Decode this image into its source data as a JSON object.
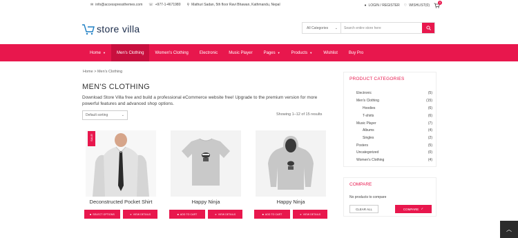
{
  "topbar": {
    "email": "info@accesspressthemes.com",
    "phone": "+977-1-4671980",
    "address": "Mathuri Sadan, 5th floor Ravi Bhawan, Kathmandu, Nepal",
    "login": "LOGIN / REGISTER",
    "wishlist": "WISHLIST(0)",
    "cart_count": "0"
  },
  "header": {
    "logo_store": "store",
    "logo_villa": "villa",
    "search": {
      "category": "All Categories",
      "placeholder": "Search entire store here"
    }
  },
  "nav": {
    "items": [
      {
        "label": "Home",
        "dropdown": true
      },
      {
        "label": "Men's Clothing",
        "dropdown": false
      },
      {
        "label": "Women's Clothing",
        "dropdown": false
      },
      {
        "label": "Electronic",
        "dropdown": false
      },
      {
        "label": "Music Player",
        "dropdown": false
      },
      {
        "label": "Pages",
        "dropdown": true
      },
      {
        "label": "Products",
        "dropdown": true
      },
      {
        "label": "Wishlist",
        "dropdown": false
      },
      {
        "label": "Buy Pro",
        "dropdown": false
      }
    ]
  },
  "main": {
    "breadcrumb": "Home > Men's Clothing",
    "title": "MEN'S CLOTHING",
    "description": "Download Store Villa free and build a professional eCommerce website free! Upgrade to the premium version for more powerful features and advanced shop options.",
    "sort": "Default sorting",
    "showing": "Showing 1–12 of 15 results",
    "products": [
      {
        "name": "Deconstructed Pocket Shirt",
        "sale": "SALE!",
        "btn1": "SELECT OPTIONS",
        "btn2": "VIEW DETAILS"
      },
      {
        "name": "Happy Ninja",
        "btn1": "ADD TO CART",
        "btn2": "VIEW DETAILS"
      },
      {
        "name": "Happy Ninja",
        "btn1": "ADD TO CART",
        "btn2": "VIEW DETAILS"
      }
    ]
  },
  "sidebar": {
    "categories_title": "PRODUCT CATEGORIES",
    "categories": [
      {
        "label": "Electronic",
        "count": "(5)",
        "sub": false
      },
      {
        "label": "Men's Clothing",
        "count": "(15)",
        "sub": false
      },
      {
        "label": "Hoodies",
        "count": "(6)",
        "sub": true
      },
      {
        "label": "T-shirts",
        "count": "(6)",
        "sub": true
      },
      {
        "label": "Music Player",
        "count": "(7)",
        "sub": false
      },
      {
        "label": "Albums",
        "count": "(4)",
        "sub": true
      },
      {
        "label": "Singles",
        "count": "(2)",
        "sub": true
      },
      {
        "label": "Posters",
        "count": "(5)",
        "sub": false
      },
      {
        "label": "Uncategorized",
        "count": "(0)",
        "sub": false
      },
      {
        "label": "Women's Clothing",
        "count": "(4)",
        "sub": false
      }
    ],
    "compare_title": "COMPARE",
    "compare_empty": "No products to compare",
    "clear_all": "CLEAR ALL",
    "compare_btn": "COMPARE"
  },
  "colors": {
    "accent": "#e8174d",
    "nav_active": "#c80f3e"
  }
}
